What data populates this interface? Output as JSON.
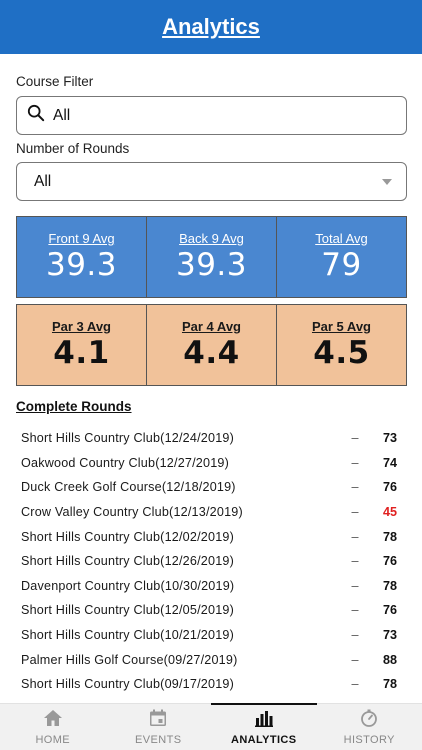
{
  "header": {
    "title": "Analytics"
  },
  "filters": {
    "course_label": "Course Filter",
    "course_value": "All",
    "rounds_label": "Number of Rounds",
    "rounds_value": "All"
  },
  "nine_stats": [
    {
      "label": "Front 9 Avg",
      "value": "39.3"
    },
    {
      "label": "Back 9 Avg",
      "value": "39.3"
    },
    {
      "label": "Total Avg",
      "value": "79"
    }
  ],
  "par_stats": [
    {
      "label": "Par 3 Avg",
      "value": "4.1"
    },
    {
      "label": "Par 4 Avg",
      "value": "4.4"
    },
    {
      "label": "Par 5 Avg",
      "value": "4.5"
    }
  ],
  "rounds_section": {
    "title": "Complete Rounds"
  },
  "rounds": [
    {
      "name": "Short Hills Country Club(12/24/2019)",
      "dash": "–",
      "score": "73"
    },
    {
      "name": "Oakwood Country Club(12/27/2019)",
      "dash": "–",
      "score": "74"
    },
    {
      "name": "Duck Creek Golf Course(12/18/2019)",
      "dash": "–",
      "score": "76"
    },
    {
      "name": "Crow Valley Country Club(12/13/2019)",
      "dash": "–",
      "score": "45"
    },
    {
      "name": "Short Hills Country Club(12/02/2019)",
      "dash": "–",
      "score": "78"
    },
    {
      "name": "Short Hills Country Club(12/26/2019)",
      "dash": "–",
      "score": "76"
    },
    {
      "name": "Davenport Country Club(10/30/2019)",
      "dash": "–",
      "score": "78"
    },
    {
      "name": "Short Hills Country Club(12/05/2019)",
      "dash": "–",
      "score": "76"
    },
    {
      "name": "Short Hills Country Club(10/21/2019)",
      "dash": "–",
      "score": "73"
    },
    {
      "name": "Palmer Hills Golf Course(09/27/2019)",
      "dash": "–",
      "score": "88"
    },
    {
      "name": "Short Hills Country Club(09/17/2019)",
      "dash": "–",
      "score": "78"
    }
  ],
  "colors": {
    "header": "#1f6fc5",
    "blue_card": "#4a87d0",
    "orange_card": "#f1c29a",
    "low_score": "#e02020"
  },
  "tabs": [
    {
      "label": "HOME",
      "icon": "home-icon",
      "active": false
    },
    {
      "label": "EVENTS",
      "icon": "calendar-icon",
      "active": false
    },
    {
      "label": "ANALYTICS",
      "icon": "bar-chart-icon",
      "active": true
    },
    {
      "label": "HISTORY",
      "icon": "stopwatch-icon",
      "active": false
    }
  ]
}
